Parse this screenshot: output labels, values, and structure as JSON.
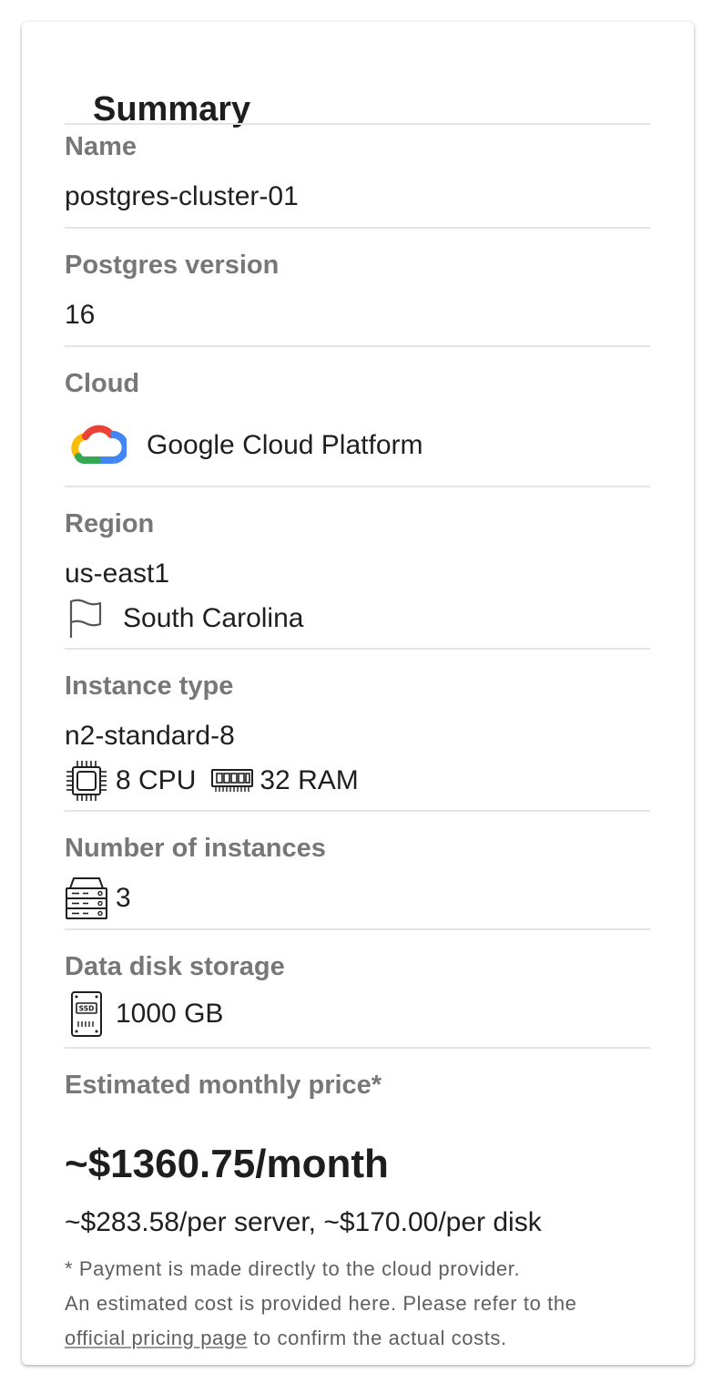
{
  "summary": {
    "title": "Summary",
    "name_label": "Name",
    "name_value": "postgres-cluster-01",
    "version_label": "Postgres version",
    "version_value": "16",
    "cloud_label": "Cloud",
    "cloud_value": "Google Cloud Platform",
    "cloud_icon": "google-cloud-icon",
    "region_label": "Region",
    "region_value": "us-east1",
    "region_location": "South Carolina",
    "region_icon": "flag-icon",
    "instance_label": "Instance type",
    "instance_value": "n2-standard-8",
    "cpu_text": "8 CPU",
    "ram_text": "32 RAM",
    "instances_label": "Number of instances",
    "instances_value": "3",
    "storage_label": "Data disk storage",
    "storage_value": "1000 GB",
    "storage_icon_text": "SSD",
    "price_label": "Estimated monthly price*",
    "price_value": "~$1360.75/month",
    "price_breakdown": "~$283.58/per server, ~$170.00/per disk",
    "note_line1": "* Payment is made directly to the cloud provider.",
    "note_line2": "An estimated cost is provided here. Please refer to the",
    "note_link": "official pricing page",
    "note_line3_rest": " to confirm the actual costs."
  },
  "colors": {
    "label": "#777777",
    "divider": "#e4e4e4",
    "google_red": "#EA4335",
    "google_blue": "#4285F4",
    "google_yellow": "#FBBC04",
    "google_green": "#34A853"
  }
}
